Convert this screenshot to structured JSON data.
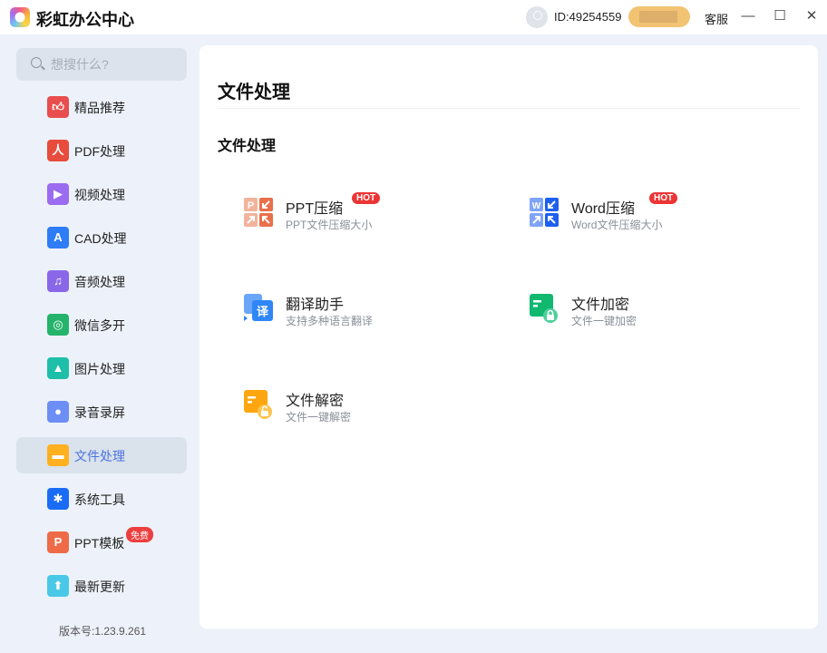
{
  "app": {
    "title": "彩虹办公中心",
    "user_id": "ID:49254559",
    "service": "客服"
  },
  "search": {
    "placeholder": "想搜什么?"
  },
  "sidebar": {
    "items": [
      {
        "label": "精品推荐",
        "icon": "thumbs-up-icon",
        "color": "#e94d4d"
      },
      {
        "label": "PDF处理",
        "icon": "pdf-icon",
        "color": "#e84c3d"
      },
      {
        "label": "视频处理",
        "icon": "video-icon",
        "color": "#9b6cf0"
      },
      {
        "label": "CAD处理",
        "icon": "cad-icon",
        "color": "#2e7cf6"
      },
      {
        "label": "音频处理",
        "icon": "music-icon",
        "color": "#8a67e8"
      },
      {
        "label": "微信多开",
        "icon": "wechat-icon",
        "color": "#24b36b"
      },
      {
        "label": "图片处理",
        "icon": "image-icon",
        "color": "#1dbfa8"
      },
      {
        "label": "录音录屏",
        "icon": "microphone-icon",
        "color": "#6c8ef5"
      },
      {
        "label": "文件处理",
        "icon": "folder-icon",
        "color": "#ffb01f",
        "active": true
      },
      {
        "label": "系统工具",
        "icon": "gear-icon",
        "color": "#1a6cf5"
      },
      {
        "label": "PPT模板",
        "icon": "ppt-icon",
        "color": "#ef6b48",
        "badge": "免费"
      },
      {
        "label": "最新更新",
        "icon": "upload-icon",
        "color": "#4ac8e8"
      }
    ],
    "version": "版本号:1.23.9.261"
  },
  "main": {
    "title": "文件处理",
    "section": "文件处理",
    "tools": [
      {
        "title": "PPT压缩",
        "subtitle": "PPT文件压缩大小",
        "badge": "HOT"
      },
      {
        "title": "Word压缩",
        "subtitle": "Word文件压缩大小",
        "badge": "HOT"
      },
      {
        "title": "翻译助手",
        "subtitle": "支持多种语言翻译"
      },
      {
        "title": "文件加密",
        "subtitle": "文件一键加密"
      },
      {
        "title": "文件解密",
        "subtitle": "文件一键解密"
      }
    ]
  }
}
